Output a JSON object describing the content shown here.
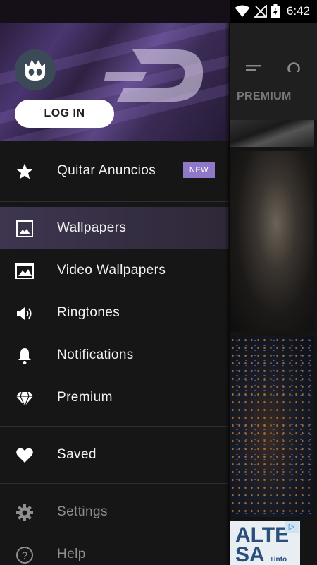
{
  "status_bar": {
    "time": "6:42"
  },
  "background_app": {
    "tabs": {
      "premium": "PREMIUM"
    },
    "ad": {
      "text_line1": "ALTE",
      "text_line2": "SA",
      "side_text": "+info",
      "badge": "▷"
    }
  },
  "drawer": {
    "login_label": "LOG IN",
    "items": [
      {
        "label": "Quitar Anuncios",
        "icon": "star-icon",
        "badge": "NEW"
      },
      {
        "label": "Wallpapers",
        "icon": "image-icon",
        "active": true
      },
      {
        "label": "Video Wallpapers",
        "icon": "video-image-icon"
      },
      {
        "label": "Ringtones",
        "icon": "speaker-icon"
      },
      {
        "label": "Notifications",
        "icon": "bell-icon"
      },
      {
        "label": "Premium",
        "icon": "diamond-icon"
      },
      {
        "label": "Saved",
        "icon": "heart-icon"
      },
      {
        "label": "Settings",
        "icon": "gear-icon"
      },
      {
        "label": "Help",
        "icon": "help-icon"
      }
    ]
  },
  "colors": {
    "accent": "#8f78c8",
    "drawer_bg": "#161616",
    "active_row": "#3e3650"
  }
}
